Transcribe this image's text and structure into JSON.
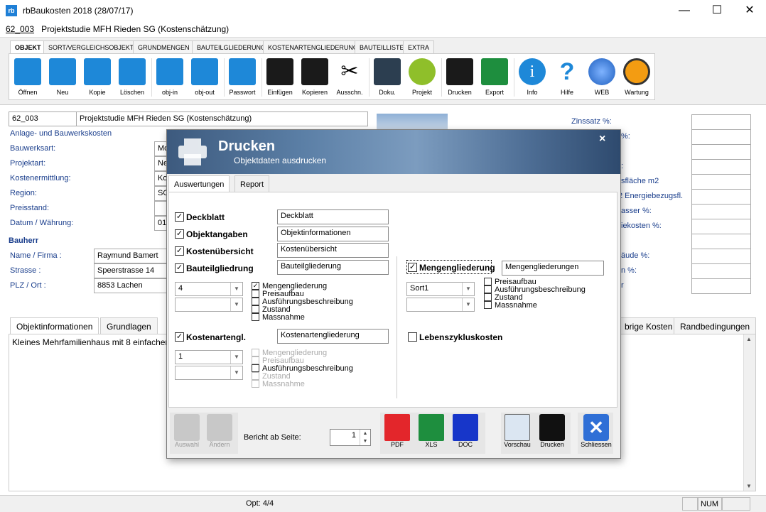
{
  "window": {
    "title": "rbBaukosten 2018 (28/07/17)",
    "app_icon_text": "rb",
    "min": "—",
    "max": "☐",
    "close": "✕"
  },
  "project_line": {
    "id": "62_003",
    "name": "Projektstudie MFH Rieden SG (Kostenschätzung)"
  },
  "ribbon": {
    "tabs": [
      "OBJEKT",
      "SORT/VERGLEICHSOBJEKTE",
      "GRUNDMENGEN",
      "BAUTEILGLIEDERUNG",
      "KOSTENARTENGLIEDERUNG",
      "BAUTEILLISTE",
      "EXTRA"
    ],
    "buttons": [
      "Öffnen",
      "Neu",
      "Kopie",
      "Löschen",
      "obj-in",
      "obj-out",
      "Passwort",
      "Einfügen",
      "Kopieren",
      "Ausschn.",
      "Doku.",
      "Projekt",
      "Drucken",
      "Export",
      "Info",
      "Hilfe",
      "WEB",
      "Wartung"
    ]
  },
  "form": {
    "id": "62_003",
    "name": "Projektstudie MFH Rieden SG (Kostenschätzung)",
    "section1": "Anlage- und Bauwerkskosten",
    "labels": [
      "Bauwerksart:",
      "Projektart:",
      "Kostenermittlung:",
      "Region:",
      "Preisstand:",
      "Datum / Währung:"
    ],
    "values": [
      "Mo",
      "Ne",
      "Ko",
      "SG",
      "",
      "01"
    ],
    "bauherr": "Bauherr",
    "bh_labels": [
      "Name / Firma :",
      "Strasse :",
      "PLZ / Ort :"
    ],
    "bh_values": [
      "Raymund Bamert",
      "Speerstrasse 14",
      "8853 Lachen"
    ],
    "right_labels": [
      "Zinssatz %:",
      "%:",
      "",
      ":",
      "sfläche m2",
      "2 Energiebezugsfl.",
      "asser %:",
      "iekosten %:",
      "",
      "äude %:",
      "n %:",
      "r"
    ]
  },
  "bottom_tabs": [
    "Objektinformationen",
    "Grundlagen",
    "brige Kosten",
    "Randbedingungen"
  ],
  "object_info_text": "Kleines Mehrfamilienhaus mit 8 einfachen",
  "status": {
    "opt": "Opt: 4/4",
    "num": "NUM"
  },
  "dialog": {
    "title": "Drucken",
    "subtitle": "Objektdaten ausdrucken",
    "close": "×",
    "tabs": [
      "Auswertungen",
      "Report"
    ],
    "main_checks": [
      {
        "label": "Deckblatt",
        "field": "Deckblatt"
      },
      {
        "label": "Objektangaben",
        "field": "Objektinformationen"
      },
      {
        "label": "Kostenübersicht",
        "field": "Kostenübersicht"
      },
      {
        "label": "Bauteilgliedrung",
        "field": "Bauteilgliederung"
      }
    ],
    "bauteil_combo1": "4",
    "bauteil_combo2": "",
    "bauteil_opts": [
      "Mengengliederung",
      "Preisaufbau",
      "Ausführungsbeschreibung",
      "Zustand",
      "Massnahme"
    ],
    "kostenart": {
      "label": "Kostenartengl.",
      "field": "Kostenartengliederung",
      "combo1": "1",
      "combo2": ""
    },
    "kostenart_opts": [
      "Mengengliederung",
      "Preisaufbau",
      "Ausführungsbeschreibung",
      "Zustand",
      "Massnahme"
    ],
    "menge": {
      "label": "Mengengliederung",
      "field": "Mengengliederungen",
      "combo1": "Sort1",
      "combo2": ""
    },
    "menge_opts": [
      "Preisaufbau",
      "Ausführungsbeschreibung",
      "Zustand",
      "Massnahme"
    ],
    "lebenszyklus": "Lebenszykluskosten",
    "footer": {
      "auswahl": "Auswahl",
      "aendern": "Ändern",
      "bericht_label": "Bericht ab Seite:",
      "bericht_value": "1",
      "pdf": "PDF",
      "xls": "XLS",
      "doc": "DOC",
      "vorschau": "Vorschau",
      "drucken": "Drucken",
      "schliessen": "Schliessen"
    }
  }
}
